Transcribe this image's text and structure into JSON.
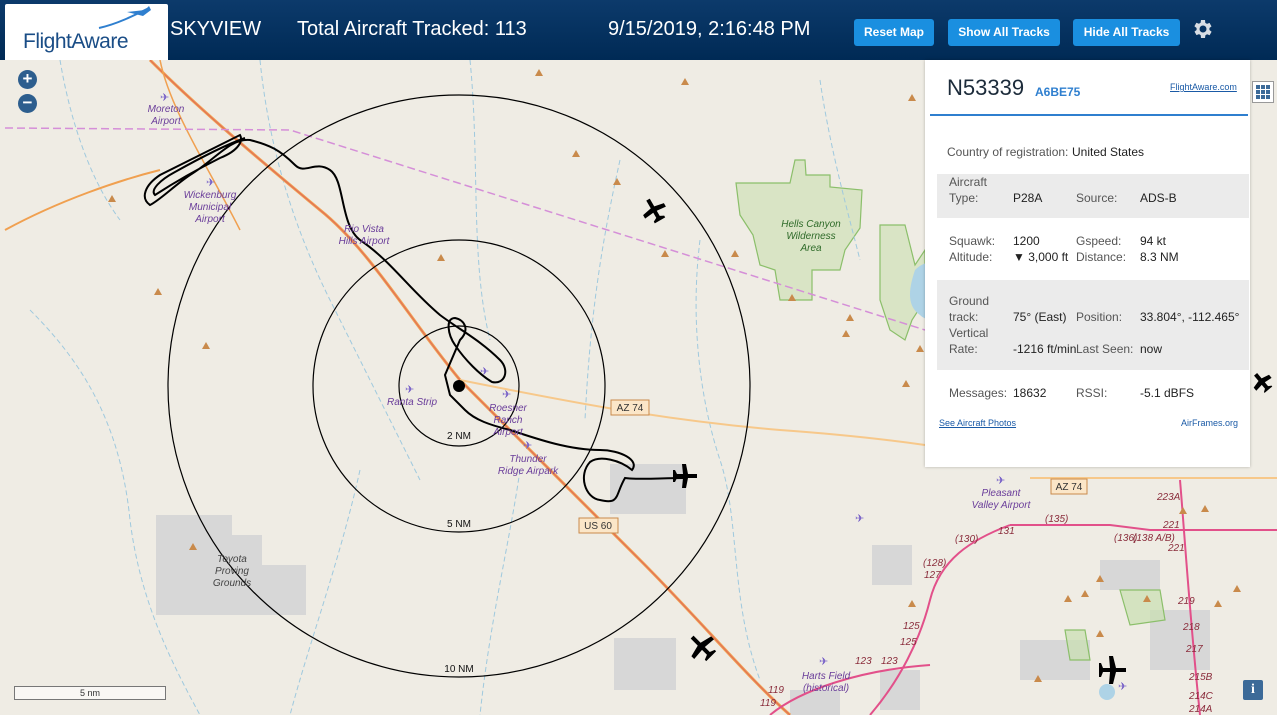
{
  "header": {
    "logo_text": "FlightAware",
    "app_name": "SKYVIEW",
    "total_label": "Total Aircraft Tracked: 113",
    "datetime": "9/15/2019, 2:16:48 PM",
    "buttons": {
      "reset": "Reset Map",
      "show_tracks": "Show All Tracks",
      "hide_tracks": "Hide All Tracks"
    }
  },
  "map": {
    "zoom_in": "+",
    "zoom_out": "−",
    "scale_label": "5 nm",
    "rings": [
      "2 NM",
      "5 NM",
      "10 NM"
    ],
    "places": [
      {
        "name": "Moreton Airport",
        "l1": "Moreton",
        "l2": "Airport"
      },
      {
        "name": "Wickenburg Municipal Airport",
        "l1": "Wickenburg",
        "l2": "Municipal",
        "l3": "Airport"
      },
      {
        "name": "Rio Vista Hills Airport",
        "l1": "Rio Vista",
        "l2": "Hills Airport"
      },
      {
        "name": "Hells Canyon Wilderness Area",
        "l1": "Hells Canyon",
        "l2": "Wilderness",
        "l3": "Area"
      },
      {
        "name": "Ranta Strip",
        "l1": "Ranta Strip"
      },
      {
        "name": "Roesner Ranch Airport",
        "l1": "Roesner",
        "l2": "Ranch",
        "l3": "Airport"
      },
      {
        "name": "Thunder Ridge Airpark",
        "l1": "Thunder",
        "l2": "Ridge Airpark"
      },
      {
        "name": "Toyota Proving Grounds",
        "l1": "Toyota",
        "l2": "Proving",
        "l3": "Grounds"
      },
      {
        "name": "Pleasant Valley Airport",
        "l1": "Pleasant",
        "l2": "Valley Airport"
      },
      {
        "name": "Harts Field (historical)",
        "l1": "Harts Field",
        "l2": "(historical)"
      }
    ],
    "roads": {
      "az74_a": "AZ 74",
      "az74_b": "AZ 74",
      "us60": "US 60"
    },
    "exits": [
      "223A",
      "221",
      "221",
      "219",
      "218",
      "217",
      "215B",
      "214C",
      "214A",
      "(130)",
      "131",
      "(135)",
      "(136)",
      "(138 A/B)",
      "(128)",
      "127",
      "125",
      "125",
      "123",
      "123",
      "119",
      "119"
    ]
  },
  "panel": {
    "registration": "N53339",
    "hex": "A6BE75",
    "fa_link": "FlightAware.com",
    "country_label": "Country of registration:",
    "country_value": "United States",
    "type_label_1": "Aircraft",
    "type_label_2": "Type:",
    "type_value": "P28A",
    "source_label": "Source:",
    "source_value": "ADS-B",
    "squawk_label": "Squawk:",
    "squawk_value": "1200",
    "gspeed_label": "Gspeed:",
    "gspeed_value": "94 kt",
    "altitude_label": "Altitude:",
    "altitude_value": "▼ 3,000 ft",
    "distance_label": "Distance:",
    "distance_value": "8.3 NM",
    "track_label_1": "Ground",
    "track_label_2": "track:",
    "track_value": "75° (East)",
    "position_label": "Position:",
    "position_value": "33.804°, -112.465°",
    "vrate_label_1": "Vertical",
    "vrate_label_2": "Rate:",
    "vrate_value": "-1216 ft/min",
    "lastseen_label": "Last Seen:",
    "lastseen_value": "now",
    "messages_label": "Messages:",
    "messages_value": "18632",
    "rssi_label": "RSSI:",
    "rssi_value": "-5.1 dBFS",
    "photos_link": "See Aircraft Photos",
    "airframes_link": "AirFrames.org"
  },
  "info_button": "i",
  "colors": {
    "header_bg": "#00305e",
    "button_bg": "#1a8fe0",
    "map_bg": "#efece4",
    "highway": "#f0a050",
    "interstate": "#e2508a",
    "water": "#aed3e6",
    "park": "#c9e0b0",
    "airport_label": "#6a3d9a",
    "accent_blue": "#2f7fcf"
  }
}
